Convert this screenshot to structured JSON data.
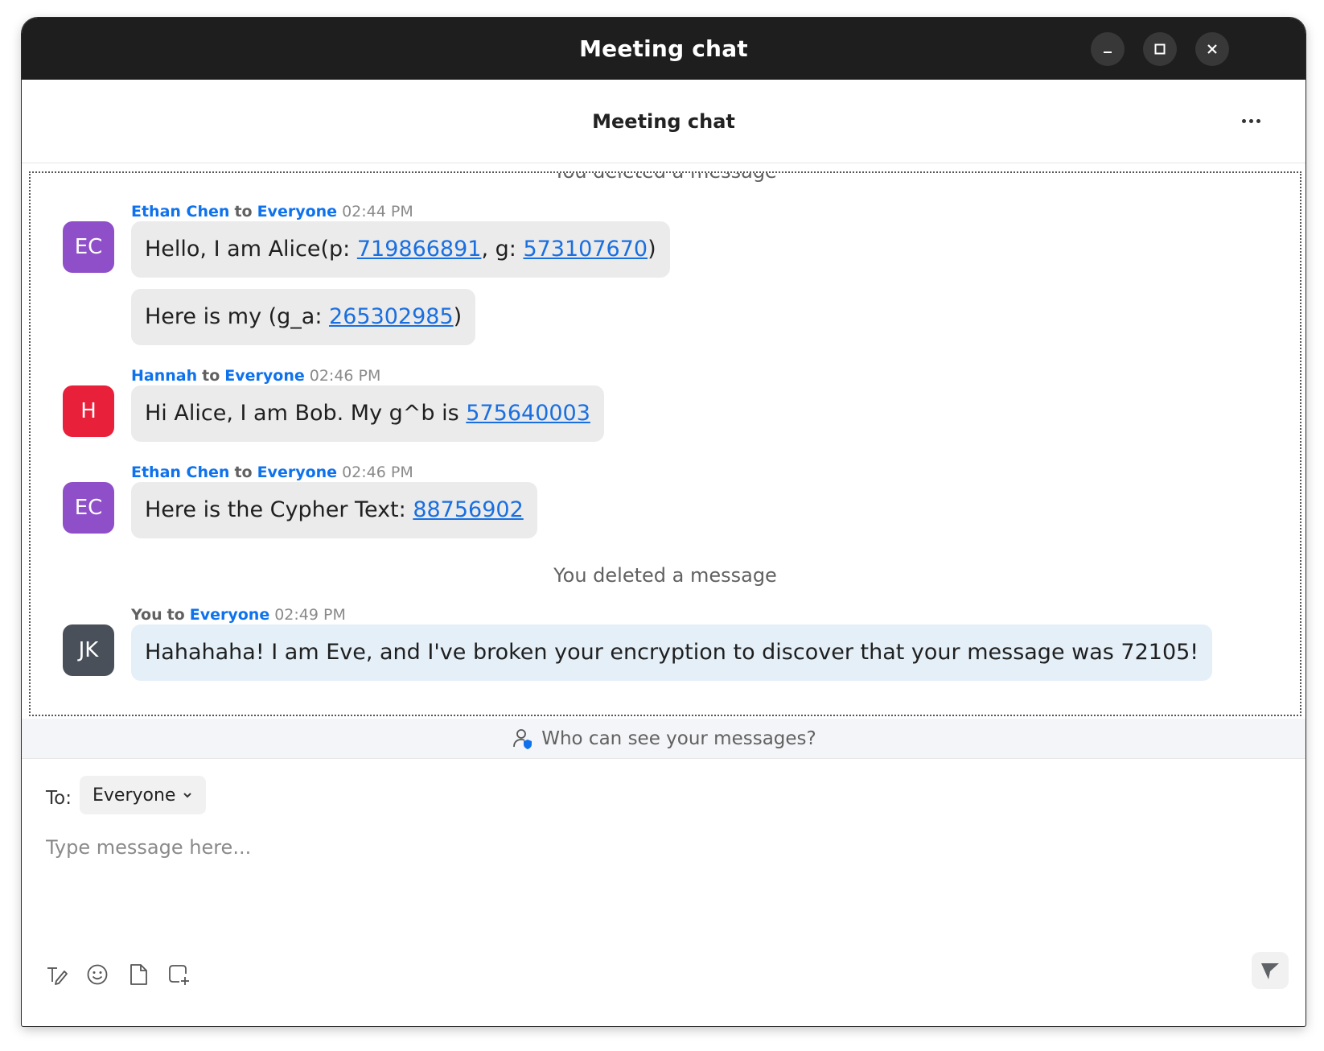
{
  "window": {
    "title": "Meeting chat"
  },
  "header": {
    "title": "Meeting chat"
  },
  "chat": {
    "system_top": "You deleted a message",
    "groups": [
      {
        "sender": "Ethan Chen",
        "to_word": "to",
        "recipient": "Everyone",
        "time": "02:44 PM",
        "avatar_initials": "EC",
        "avatar_color": "#8f4fc9",
        "messages": [
          {
            "prefix": "Hello, I am Alice(p: ",
            "link1": "719866891",
            "middle": ", g: ",
            "link2": "573107670",
            "suffix": ")"
          },
          {
            "prefix": "Here is my (g_a: ",
            "link1": "265302985",
            "suffix": ")"
          }
        ]
      },
      {
        "sender": "Hannah",
        "to_word": "to",
        "recipient": "Everyone",
        "time": "02:46 PM",
        "avatar_initials": "H",
        "avatar_color": "#e8203a",
        "messages": [
          {
            "prefix": "Hi Alice, I am Bob. My g^b is ",
            "link1": "575640003"
          }
        ]
      },
      {
        "sender": "Ethan Chen",
        "to_word": "to",
        "recipient": "Everyone",
        "time": "02:46 PM",
        "avatar_initials": "EC",
        "avatar_color": "#8f4fc9",
        "messages": [
          {
            "prefix": "Here is the Cypher Text: ",
            "link1": "88756902"
          }
        ]
      }
    ],
    "system_deleted": "You deleted a message",
    "own": {
      "sender": "You",
      "to_word": "to",
      "recipient": "Everyone",
      "time": "02:49 PM",
      "avatar_initials": "JK",
      "avatar_color": "#4a5059",
      "text": "Hahahaha! I am Eve, and I've broken your encryption to discover that your message was 72105!"
    }
  },
  "info_bar": {
    "text": "Who can see your messages?"
  },
  "compose": {
    "to_label": "To:",
    "recipient": "Everyone",
    "placeholder": "Type message here..."
  },
  "icons": {
    "minimize": "minimize-icon",
    "maximize": "maximize-icon",
    "close": "close-icon",
    "more": "more-options-icon",
    "privacy": "user-shield-icon",
    "format": "text-format-icon",
    "emoji": "emoji-icon",
    "file": "file-icon",
    "screenshot": "screenshot-icon",
    "send": "send-icon"
  },
  "colors": {
    "accent": "#0e72ed",
    "link": "#1a6fe0",
    "titlebar": "#1e1e1e"
  }
}
